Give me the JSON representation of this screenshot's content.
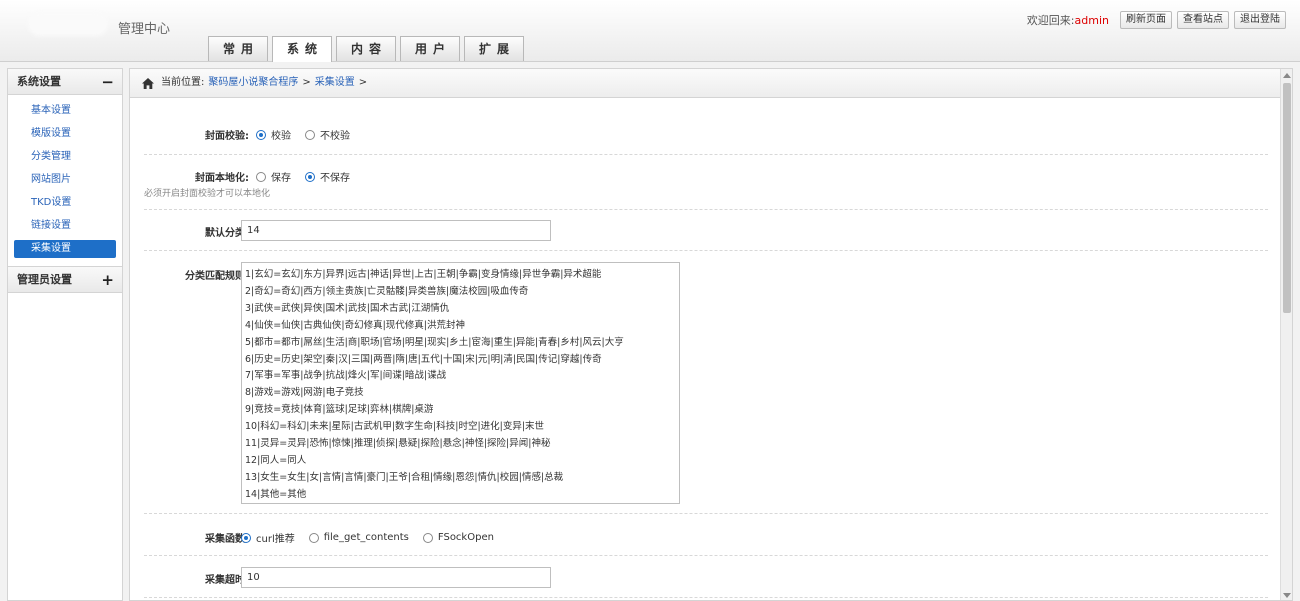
{
  "header": {
    "title": "管理中心",
    "tabs": [
      "常用",
      "系统",
      "内容",
      "用户",
      "扩展"
    ],
    "active_tab": 1,
    "welcome": "欢迎回来:",
    "user": "admin",
    "buttons": [
      "刷新页面",
      "查看站点",
      "退出登陆"
    ]
  },
  "sidebar": {
    "group1": {
      "title": "系统设置",
      "toggle": "−"
    },
    "items": [
      "基本设置",
      "模版设置",
      "分类管理",
      "网站图片",
      "TKD设置",
      "链接设置",
      "采集设置"
    ],
    "active_item": 6,
    "group2": {
      "title": "管理员设置",
      "toggle": "+"
    }
  },
  "breadcrumb": {
    "prefix": "当前位置:",
    "links": [
      "聚码屋小说聚合程序",
      "采集设置"
    ],
    "sep": ">"
  },
  "form": {
    "cover_check": {
      "label": "封面校验:",
      "options": [
        "校验",
        "不校验"
      ],
      "selected": 0
    },
    "cover_local": {
      "label": "封面本地化:",
      "options": [
        "保存",
        "不保存"
      ],
      "selected": 1,
      "hint": "必须开启封面校验才可以本地化"
    },
    "default_category": {
      "label": "默认分类:",
      "value": "14"
    },
    "category_rules": {
      "label": "分类匹配规则:",
      "lines": [
        "1|玄幻=玄幻|东方|异界|远古|神话|异世|上古|王朝|争霸|变身情缘|异世争霸|异术超能",
        "2|奇幻=奇幻|西方|领主贵族|亡灵骷髅|异类兽族|魔法校园|吸血传奇",
        "3|武侠=武侠|异侠|国术|武技|国术古武|江湖情仇",
        "4|仙侠=仙侠|古典仙侠|奇幻修真|现代修真|洪荒封神",
        "5|都市=都市|屌丝|生活|商|职场|官场|明星|现实|乡土|宦海|重生|异能|青春|乡村|风云|大亨",
        "6|历史=历史|架空|秦|汉|三国|两晋|隋|唐|五代|十国|宋|元|明|清|民国|传记|穿越|传奇",
        "7|军事=军事|战争|抗战|烽火|军|间谍|暗战|谍战",
        "8|游戏=游戏|网游|电子竞技",
        "9|竞技=竞技|体育|篮球|足球|弈林|棋牌|桌游",
        "10|科幻=科幻|未来|星际|古武机甲|数字生命|科技|时空|进化|变异|末世",
        "11|灵异=灵异|恐怖|惊悚|推理|侦探|悬疑|探险|悬念|神怪|探险|异闻|神秘",
        "12|同人=同人",
        "13|女生=女生|女|言情|言情|豪门|王爷|合租|情缘|恩怨|情仇|校园|情感|总裁",
        "14|其他=其他"
      ]
    },
    "collect_func": {
      "label": "采集函数:",
      "options": [
        "curl推荐",
        "file_get_contents",
        "FSockOpen"
      ],
      "selected": 0
    },
    "collect_timeout": {
      "label": "采集超时:",
      "value": "10"
    }
  },
  "colors": {
    "accent": "#1e6fc8",
    "link": "#2a63b8",
    "admin_name": "#dd0000"
  },
  "icons": {
    "breadcrumb": "home-icon",
    "group1_toggle": "minus-icon",
    "group2_toggle": "plus-icon"
  }
}
